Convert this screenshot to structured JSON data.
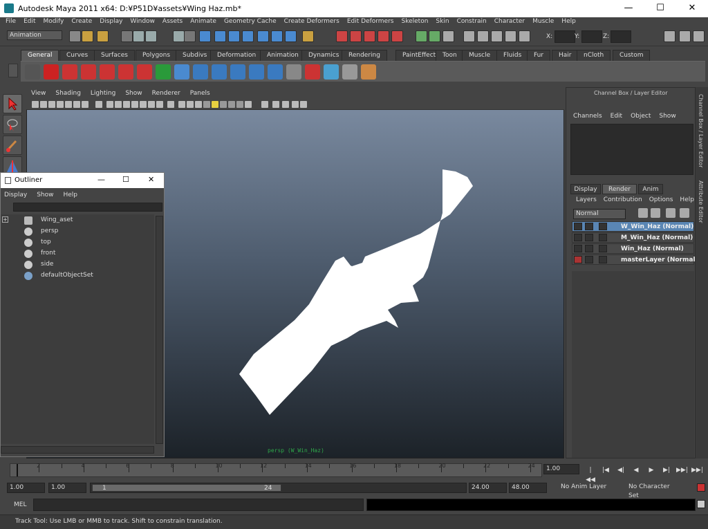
{
  "window": {
    "title": "Autodesk Maya 2011 x64: D:¥P51D¥assets¥Wing Haz.mb*",
    "min": "—",
    "max": "☐",
    "close": "✕"
  },
  "menu": [
    "File",
    "Edit",
    "Modify",
    "Create",
    "Display",
    "Window",
    "Assets",
    "Animate",
    "Geometry Cache",
    "Create Deformers",
    "Edit Deformers",
    "Skeleton",
    "Skin",
    "Constrain",
    "Character",
    "Muscle",
    "Help"
  ],
  "status": {
    "mode": "Animation",
    "x_label": "X:",
    "y_label": "Y:",
    "z_label": "Z:"
  },
  "shelf_tabs": [
    "General",
    "Curves",
    "Surfaces",
    "Polygons",
    "Subdivs",
    "Deformation",
    "Animation",
    "Dynamics",
    "Rendering",
    "PaintEffects",
    "Toon",
    "Muscle",
    "Fluids",
    "Fur",
    "Hair",
    "nCloth",
    "Custom"
  ],
  "viewport": {
    "menu": [
      "View",
      "Shading",
      "Lighting",
      "Show",
      "Renderer",
      "Panels"
    ],
    "camera_label": "persp (W_Win_Haz)"
  },
  "outliner": {
    "title": "Outliner",
    "menu": [
      "Display",
      "Show",
      "Help"
    ],
    "items": [
      "Wing_aset",
      "persp",
      "top",
      "front",
      "side",
      "defaultObjectSet"
    ],
    "expand": "+"
  },
  "channel_box": {
    "title": "Channel Box / Layer Editor",
    "menu": [
      "Channels",
      "Edit",
      "Object",
      "Show"
    ],
    "tabs": [
      "Display",
      "Render",
      "Anim"
    ],
    "layer_menu": [
      "Layers",
      "Contribution",
      "Options",
      "Help"
    ],
    "blend_mode": "Normal",
    "layers": [
      "W_Win_Haz (Normal)",
      "M_Win_Haz (Normal)",
      "Win_Haz (Normal)",
      "masterLayer (Normal)"
    ]
  },
  "side_tabs": {
    "channel": "Channel Box / Layer Editor",
    "attr": "Attribute Editor"
  },
  "time": {
    "ticks": [
      "2",
      "4",
      "6",
      "8",
      "10",
      "12",
      "14",
      "16",
      "18",
      "20",
      "22",
      "24"
    ],
    "current": "1.00"
  },
  "range": {
    "start": "1.00",
    "start2": "1.00",
    "slider_start": "1",
    "slider_end": "24",
    "end": "24.00",
    "end2": "48.00",
    "anim_layer": "No Anim Layer",
    "char_set": "No Character Set"
  },
  "cmd": {
    "label": "MEL"
  },
  "help": {
    "text": "Track Tool: Use LMB or MMB to track. Shift to constrain translation."
  },
  "playback": [
    "|◀◀",
    "|◀",
    "◀|",
    "◀",
    "▶",
    "▶|",
    "▶▶|",
    "▶▶|"
  ]
}
